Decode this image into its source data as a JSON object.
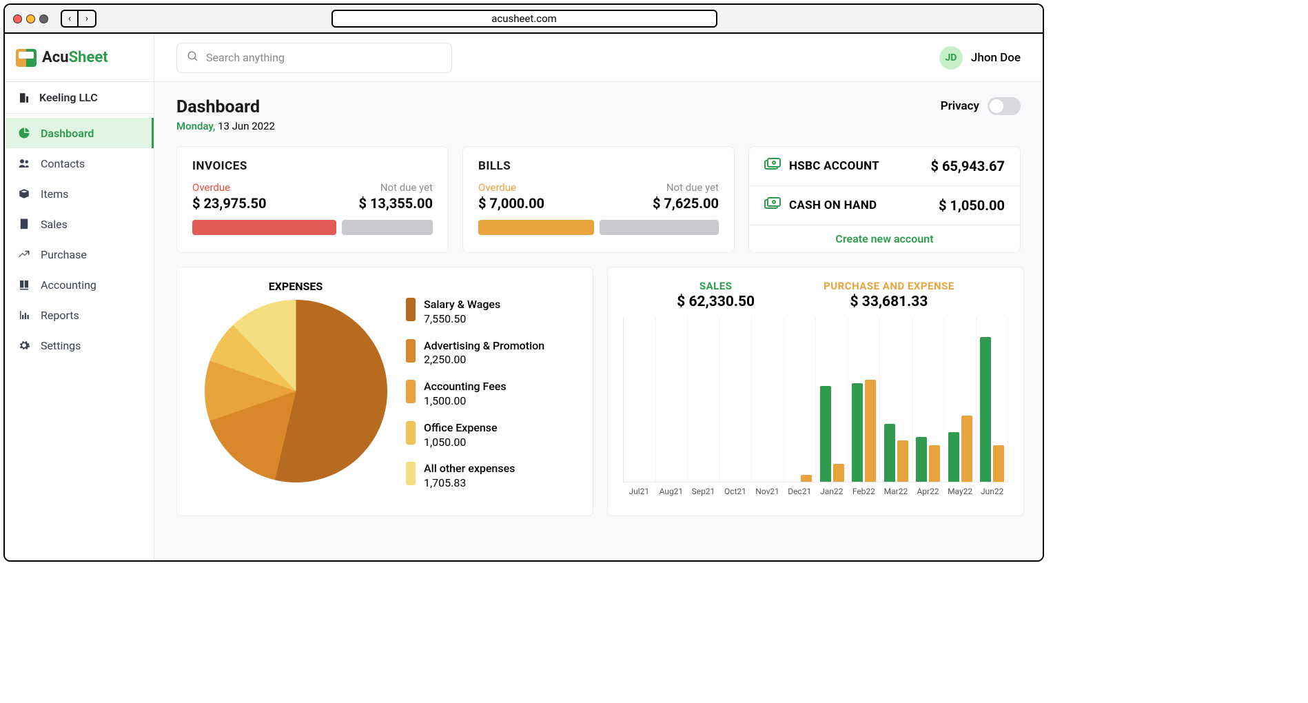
{
  "browser": {
    "url": "acusheet.com"
  },
  "app_name": {
    "acu": "Acu",
    "sheet": "Sheet"
  },
  "company": "Keeling LLC",
  "nav": [
    {
      "label": "Dashboard",
      "icon": "pie"
    },
    {
      "label": "Contacts",
      "icon": "users"
    },
    {
      "label": "Items",
      "icon": "box"
    },
    {
      "label": "Sales",
      "icon": "receipt"
    },
    {
      "label": "Purchase",
      "icon": "trend"
    },
    {
      "label": "Accounting",
      "icon": "book"
    },
    {
      "label": "Reports",
      "icon": "chart"
    },
    {
      "label": "Settings",
      "icon": "gear"
    }
  ],
  "search_placeholder": "Search anything",
  "user": {
    "initials": "JD",
    "name": "Jhon Doe"
  },
  "page": {
    "title": "Dashboard",
    "date_weekday": "Monday,",
    "date_rest": " 13 Jun 2022",
    "privacy_label": "Privacy"
  },
  "invoices": {
    "title": "INVOICES",
    "overdue_label": "Overdue",
    "overdue_value": "$ 23,975.50",
    "notdue_label": "Not due yet",
    "notdue_value": "$ 13,355.00",
    "bar_overdue_color": "#e25a55",
    "bar_notdue_color": "#c7c9cc",
    "bar_overdue_pct": 60
  },
  "bills": {
    "title": "BILLS",
    "overdue_label": "Overdue",
    "overdue_value": "$ 7,000.00",
    "notdue_label": "Not due yet",
    "notdue_value": "$ 7,625.00",
    "bar_overdue_color": "#e8a33d",
    "bar_notdue_color": "#c7c9cc",
    "bar_overdue_pct": 48
  },
  "accounts": {
    "items": [
      {
        "name": "HSBC ACCOUNT",
        "value": "$ 65,943.67"
      },
      {
        "name": "CASH ON HAND",
        "value": "$ 1,050.00"
      }
    ],
    "create_label": "Create new account"
  },
  "expenses": {
    "title": "EXPENSES",
    "items": [
      {
        "name": "Salary & Wages",
        "value": "7,550.50",
        "color": "#b76b1e"
      },
      {
        "name": "Advertising & Promotion",
        "value": "2,250.00",
        "color": "#d8872b"
      },
      {
        "name": "Accounting Fees",
        "value": "1,500.00",
        "color": "#e8a33d"
      },
      {
        "name": "Office Expense",
        "value": "1,050.00",
        "color": "#f1c356"
      },
      {
        "name": "All other expenses",
        "value": "1,705.83",
        "color": "#f6dd7f"
      }
    ]
  },
  "sales_purchase": {
    "sales_label": "SALES",
    "sales_value": "$ 62,330.50",
    "purchase_label": "PURCHASE AND EXPENSE",
    "purchase_value": "$ 33,681.33"
  },
  "chart_data": {
    "type": "bar",
    "title": "Sales vs Purchase and Expense",
    "xlabel": "",
    "ylabel": "",
    "ylim": [
      0,
      100
    ],
    "categories": [
      "Jul21",
      "Aug21",
      "Sep21",
      "Oct21",
      "Nov21",
      "Dec21",
      "Jan22",
      "Feb22",
      "Mar22",
      "Apr22",
      "May22",
      "Jun22"
    ],
    "series": [
      {
        "name": "SALES",
        "color": "#2e9b4f",
        "values": [
          0,
          0,
          0,
          0,
          0,
          0,
          58,
          60,
          35,
          27,
          30,
          88
        ]
      },
      {
        "name": "PURCHASE AND EXPENSE",
        "color": "#e8a33d",
        "values": [
          0,
          0,
          0,
          0,
          0,
          4,
          11,
          62,
          25,
          22,
          40,
          22
        ]
      }
    ]
  },
  "pie_chart_data": {
    "type": "pie",
    "title": "EXPENSES",
    "series": [
      {
        "name": "Salary & Wages",
        "value": 7550.5,
        "color": "#b76b1e"
      },
      {
        "name": "Advertising & Promotion",
        "value": 2250.0,
        "color": "#d8872b"
      },
      {
        "name": "Accounting Fees",
        "value": 1500.0,
        "color": "#e8a33d"
      },
      {
        "name": "Office Expense",
        "value": 1050.0,
        "color": "#f1c356"
      },
      {
        "name": "All other expenses",
        "value": 1705.83,
        "color": "#f6dd7f"
      }
    ]
  }
}
